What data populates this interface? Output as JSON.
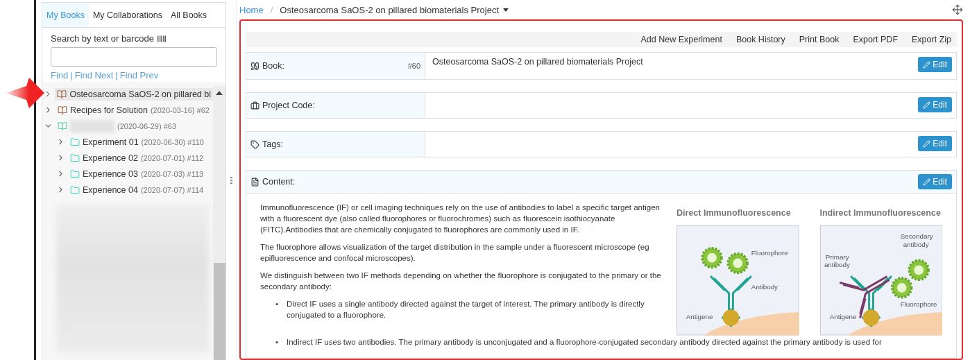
{
  "sidebar": {
    "tabs": [
      {
        "label": "My Books",
        "selected": true
      },
      {
        "label": "My Collaborations",
        "selected": false
      },
      {
        "label": "All Books",
        "selected": false
      }
    ],
    "search": {
      "label": "Search by text or barcode"
    },
    "find_links": [
      "Find",
      "Find Next",
      "Find Prev"
    ],
    "find_separator": "|",
    "tree": [
      {
        "name": "Osteosarcoma SaOS-2 on pillared bi",
        "expanded": false,
        "selected": true,
        "redacted": false,
        "kind": "book"
      },
      {
        "name": "Recipes for Solution",
        "meta": "(2020-03-16) #62",
        "expanded": false,
        "selected": false,
        "redacted": false,
        "kind": "book"
      },
      {
        "meta": "(2020-06-29) #63",
        "expanded": true,
        "selected": false,
        "redacted": true,
        "kind": "book",
        "children": [
          {
            "name": "Experiment 01",
            "meta": "(2020-06-30) #110",
            "expanded": false,
            "selected": false,
            "redacted": false,
            "kind": "folder"
          },
          {
            "name": "Experience 02",
            "meta": "(2020-07-01) #112",
            "expanded": false,
            "selected": false,
            "redacted": false,
            "kind": "folder"
          },
          {
            "name": "Experience 03",
            "meta": "(2020-07-03) #113",
            "expanded": false,
            "selected": false,
            "redacted": false,
            "kind": "folder"
          },
          {
            "name": "Experience 04",
            "meta": "(2020-07-07) #114",
            "expanded": false,
            "selected": false,
            "redacted": false,
            "kind": "folder"
          }
        ]
      }
    ]
  },
  "breadcrumb": {
    "home": "Home",
    "separator": "/",
    "current": "Osteosarcoma SaOS-2 on pillared biomaterials Project"
  },
  "toolbar": [
    "Add New Experiment",
    "Book History",
    "Print Book",
    "Export PDF",
    "Export Zip"
  ],
  "fields": [
    {
      "kind": "book",
      "label": "Book:",
      "number": "#60",
      "value": "Osteosarcoma SaOS-2 on pillared biomaterials Project",
      "button": "Edit"
    },
    {
      "kind": "code",
      "label": "Project Code:",
      "button": "Edit"
    },
    {
      "kind": "tags",
      "label": "Tags:",
      "button": "Edit"
    }
  ],
  "content": {
    "label": "Content:",
    "button": "Edit",
    "paragraphs": [
      "Immunofluorescence (IF) or cell imaging techniques rely on the use of antibodies to label a specific target antigen with a fluorescent dye (also called fluorophores or fluorochromes) such as fluorescein isothiocyanate (FITC).Antibodies that are chemically conjugated to fluorophores are commonly used in IF.",
      "The fluorophore allows visualization of the target distribution in the sample under a fluorescent microscope (eg epifluorescence and confocal microscopes).",
      "We distinguish between two IF methods depending on whether the fluorophore is conjugated to the primary or the secondary antibody:"
    ],
    "bullets": [
      {
        "marker": "•",
        "text": "Direct IF uses a single antibody directed against the target of interest. The primary antibody is directly conjugated to a fluorophore."
      },
      {
        "marker": "•",
        "text": "Indirect IF uses two antibodies. The primary antibody is unconjugated and a fluorophore-conjugated secondary antibody directed against the primary antibody is used for"
      }
    ],
    "figure": [
      {
        "kind": "direct",
        "title": "Direct Immunofluorescence",
        "labels": [
          "Fluorophore",
          "Antibody",
          "Antigene"
        ]
      },
      {
        "kind": "indirect",
        "title": "Indirect Immunofluorescence",
        "labels": [
          "Secondary",
          "antibody",
          "Primary",
          "antibody",
          "Fluorophore",
          "Antigene"
        ]
      }
    ]
  }
}
